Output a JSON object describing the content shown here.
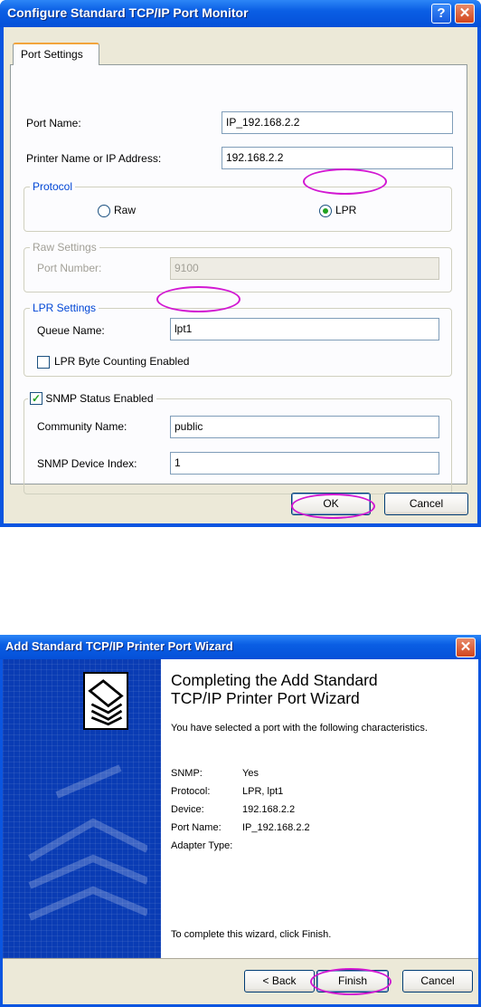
{
  "dialog1": {
    "title": "Configure Standard TCP/IP Port Monitor",
    "help_glyph": "?",
    "close_glyph": "✕",
    "tab": "Port Settings",
    "port_name_label": "Port Name:",
    "port_name_value": "IP_192.168.2.2",
    "printer_label": "Printer Name or IP Address:",
    "printer_value": "192.168.2.2",
    "protocol": {
      "legend": "Protocol",
      "raw_label": "Raw",
      "lpr_label": "LPR",
      "selected": "LPR"
    },
    "raw_settings": {
      "legend": "Raw Settings",
      "port_number_label": "Port Number:",
      "port_number_value": "9100"
    },
    "lpr_settings": {
      "legend": "LPR Settings",
      "queue_name_label": "Queue Name:",
      "queue_name_value": "lpt1",
      "byte_counting_label": "LPR Byte Counting Enabled",
      "byte_counting_checked": false
    },
    "snmp": {
      "label": "SNMP Status Enabled",
      "checked": true,
      "community_label": "Community Name:",
      "community_value": "public",
      "device_index_label": "SNMP Device Index:",
      "device_index_value": "1"
    },
    "ok_label": "OK",
    "cancel_label": "Cancel",
    "highlight_color": "#d218d2"
  },
  "dialog2": {
    "title": "Add Standard TCP/IP Printer Port Wizard",
    "close_glyph": "✕",
    "heading_line1": "Completing the Add Standard",
    "heading_line2": "TCP/IP Printer Port Wizard",
    "intro": "You have selected a port with the following characteristics.",
    "rows": [
      {
        "key": "SNMP:",
        "value": "Yes"
      },
      {
        "key": "Protocol:",
        "value": "LPR, lpt1"
      },
      {
        "key": "Device:",
        "value": "192.168.2.2"
      },
      {
        "key": "Port Name:",
        "value": "IP_192.168.2.2"
      },
      {
        "key": "Adapter Type:",
        "value": ""
      }
    ],
    "footer": "To complete this wizard, click Finish.",
    "back_label": "< Back",
    "finish_label": "Finish",
    "cancel_label": "Cancel"
  }
}
